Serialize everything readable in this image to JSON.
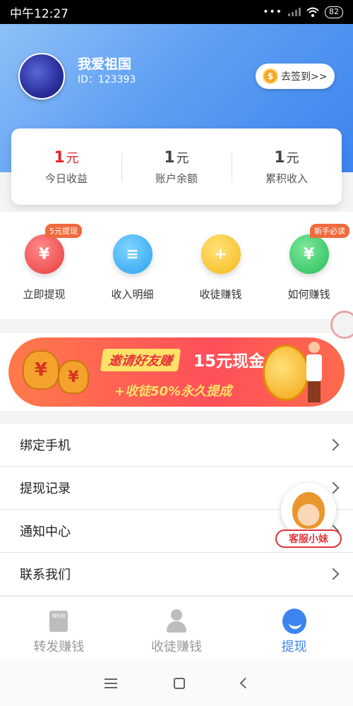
{
  "status_bar": {
    "time": "中午12:27",
    "battery": "82"
  },
  "profile": {
    "name": "我爱祖国",
    "id_text": "ID：123393"
  },
  "checkin": {
    "label": "去签到>>",
    "coin_symbol": "$"
  },
  "balance": [
    {
      "value": "1",
      "unit": "元",
      "label": "今日收益"
    },
    {
      "value": "1",
      "unit": "元",
      "label": "账户余额"
    },
    {
      "value": "1",
      "unit": "元",
      "label": "累积收入"
    }
  ],
  "quick_actions": [
    {
      "label": "立即提现",
      "badge": "5元提现",
      "icon": "yen-icon",
      "symbol": "¥"
    },
    {
      "label": "收入明细",
      "badge": "",
      "icon": "document-icon",
      "symbol": "≡"
    },
    {
      "label": "收徒赚钱",
      "badge": "",
      "icon": "add-user-icon",
      "symbol": "+"
    },
    {
      "label": "如何赚钱",
      "badge": "新手必读",
      "icon": "envelope-icon",
      "symbol": "¥"
    }
  ],
  "banner": {
    "tag": "邀请好友赚",
    "cash": "15元现金",
    "sub": "+收徒50%永久提成",
    "bag_symbol": "¥"
  },
  "menu": [
    {
      "label": "绑定手机"
    },
    {
      "label": "提现记录"
    },
    {
      "label": "通知中心"
    },
    {
      "label": "联系我们"
    }
  ],
  "customer_service": {
    "label": "客服小妹"
  },
  "bottom_nav": [
    {
      "label": "转发赚钱",
      "icon": "news-icon"
    },
    {
      "label": "收徒赚钱",
      "icon": "user-icon"
    },
    {
      "label": "提现",
      "icon": "cash-icon",
      "active": true
    }
  ],
  "colors": {
    "primary": "#3c84ee",
    "accent_red": "#e0262a",
    "badge_orange": "#f06a3c"
  }
}
